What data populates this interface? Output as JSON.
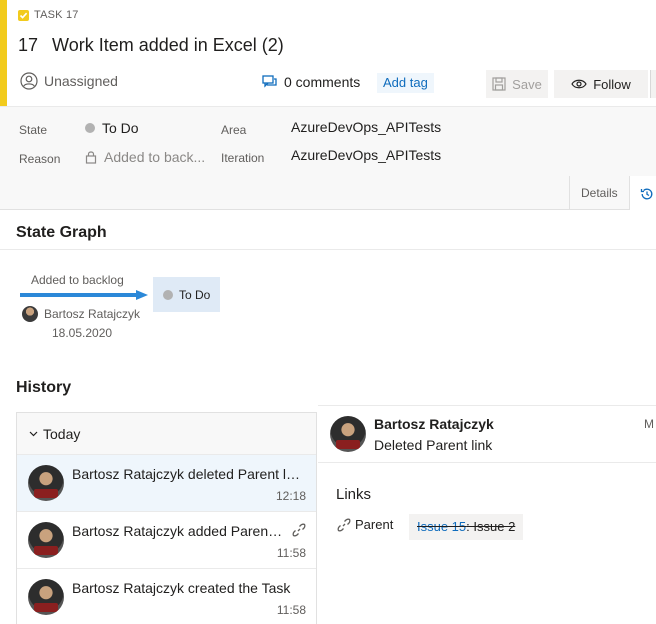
{
  "work_item": {
    "type_label": "TASK 17",
    "id": "17",
    "title": "Work Item added in Excel (2)",
    "assigned": "Unassigned",
    "comments": "0 comments",
    "add_tag": "Add tag",
    "save_label": "Save",
    "follow_label": "Follow"
  },
  "fields": {
    "state_label": "State",
    "state_value": "To Do",
    "reason_label": "Reason",
    "reason_value": "Added to back...",
    "area_label": "Area",
    "area_value": "AzureDevOps_APITests",
    "iteration_label": "Iteration",
    "iteration_value": "AzureDevOps_APITests"
  },
  "tabs": {
    "details": "Details"
  },
  "state_graph": {
    "title": "State Graph",
    "transition_label": "Added to backlog",
    "user": "Bartosz Ratajczyk",
    "date": "18.05.2020",
    "state": "To Do"
  },
  "history": {
    "title": "History",
    "group_label": "Today",
    "items": [
      {
        "text": "Bartosz Ratajczyk deleted Parent link",
        "time": "12:18"
      },
      {
        "text": "Bartosz Ratajczyk added Parent l...",
        "time": "11:58"
      },
      {
        "text": "Bartosz Ratajczyk created the Task",
        "time": "11:58"
      }
    ],
    "detail": {
      "name": "Bartosz Ratajczyk",
      "description": "Deleted Parent link",
      "partial_right": "M"
    },
    "links": {
      "title": "Links",
      "parent_label": "Parent",
      "issue_id": "Issue 15",
      "issue_title": ": Issue 2"
    }
  },
  "colors": {
    "accent_yellow": "#f2cb1d",
    "link_blue": "#0f6cbd",
    "state_box": "#dfeaf6",
    "arrow_blue": "#2b88d8"
  }
}
